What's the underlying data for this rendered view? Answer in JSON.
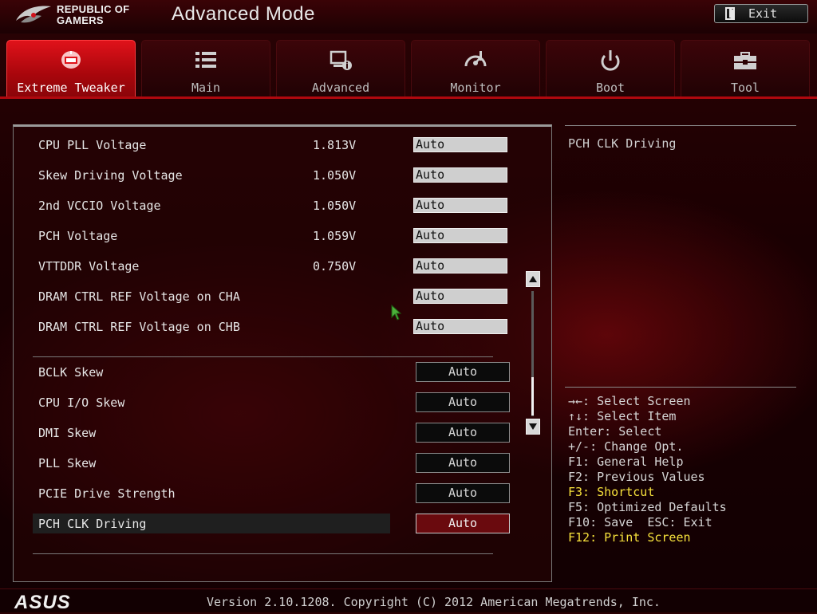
{
  "header": {
    "brand_line1": "REPUBLIC OF",
    "brand_line2": "GAMERS",
    "title": "Advanced Mode",
    "exit_label": "Exit"
  },
  "tabs": [
    {
      "label": "Extreme Tweaker",
      "icon": "extreme-tweaker-icon",
      "active": true
    },
    {
      "label": "Main",
      "icon": "list-icon",
      "active": false
    },
    {
      "label": "Advanced",
      "icon": "advanced-icon",
      "active": false
    },
    {
      "label": "Monitor",
      "icon": "monitor-gauge-icon",
      "active": false
    },
    {
      "label": "Boot",
      "icon": "power-icon",
      "active": false
    },
    {
      "label": "Tool",
      "icon": "toolbox-icon",
      "active": false
    }
  ],
  "voltages": [
    {
      "label": "CPU PLL Voltage",
      "value": "1.813V",
      "setting": "Auto"
    },
    {
      "label": "Skew Driving Voltage",
      "value": "1.050V",
      "setting": "Auto"
    },
    {
      "label": "2nd VCCIO Voltage",
      "value": "1.050V",
      "setting": "Auto"
    },
    {
      "label": "PCH Voltage",
      "value": "1.059V",
      "setting": "Auto"
    },
    {
      "label": "VTTDDR Voltage",
      "value": "0.750V",
      "setting": "Auto"
    },
    {
      "label": "DRAM CTRL REF Voltage on CHA",
      "value": "",
      "setting": "Auto"
    },
    {
      "label": "DRAM CTRL REF Voltage on CHB",
      "value": "",
      "setting": "Auto"
    }
  ],
  "skews": [
    {
      "label": "BCLK Skew",
      "setting": "Auto"
    },
    {
      "label": "CPU I/O Skew",
      "setting": "Auto"
    },
    {
      "label": "DMI Skew",
      "setting": "Auto"
    },
    {
      "label": "PLL Skew",
      "setting": "Auto"
    },
    {
      "label": "PCIE Drive Strength",
      "setting": "Auto"
    },
    {
      "label": "PCH CLK Driving",
      "setting": "Auto",
      "selected": true
    }
  ],
  "help": {
    "title": "PCH CLK Driving",
    "keys": [
      {
        "text": "→←: Select Screen",
        "highlight": false
      },
      {
        "text": "↑↓: Select Item",
        "highlight": false
      },
      {
        "text": "Enter: Select",
        "highlight": false
      },
      {
        "text": "+/-: Change Opt.",
        "highlight": false
      },
      {
        "text": "F1: General Help",
        "highlight": false
      },
      {
        "text": "F2: Previous Values",
        "highlight": false
      },
      {
        "text": "F3: Shortcut",
        "highlight": true
      },
      {
        "text": "F5: Optimized Defaults",
        "highlight": false
      },
      {
        "text": "F10: Save  ESC: Exit",
        "highlight": false
      },
      {
        "text": "F12: Print Screen",
        "highlight": true
      }
    ]
  },
  "footer": {
    "logo": "ASUS",
    "version": "Version 2.10.1208. Copyright (C) 2012 American Megatrends, Inc."
  },
  "colors": {
    "accent_red": "#e0121a",
    "selected_value_bg": "#6a0a0e",
    "shortcut_yellow": "#f7e23c"
  }
}
